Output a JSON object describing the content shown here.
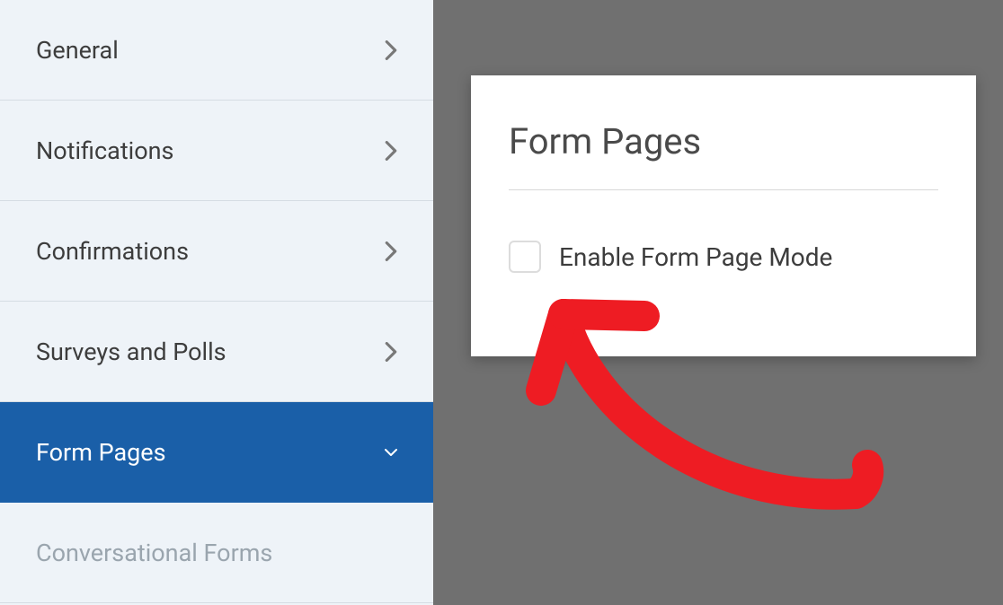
{
  "sidebar": {
    "items": [
      {
        "label": "General",
        "active": false,
        "disabled": false
      },
      {
        "label": "Notifications",
        "active": false,
        "disabled": false
      },
      {
        "label": "Confirmations",
        "active": false,
        "disabled": false
      },
      {
        "label": "Surveys and Polls",
        "active": false,
        "disabled": false
      },
      {
        "label": "Form Pages",
        "active": true,
        "disabled": false
      },
      {
        "label": "Conversational Forms",
        "active": false,
        "disabled": true
      }
    ]
  },
  "panel": {
    "title": "Form Pages",
    "checkbox_label": "Enable Form Page Mode"
  }
}
